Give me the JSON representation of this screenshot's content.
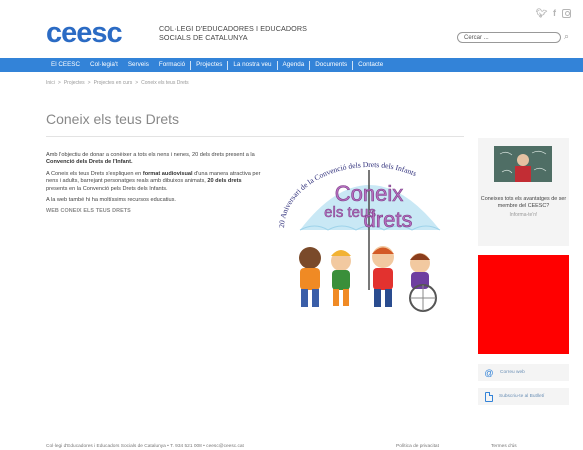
{
  "header": {
    "logo": "ceesc",
    "subtitle_line1": "COL·LEGI D'EDUCADORES I EDUCADORS",
    "subtitle_line2": "SOCIALS DE CATALUNYA",
    "search_value": "Cercar ...",
    "social_icons": [
      "twitter-icon",
      "facebook-icon",
      "instagram-icon"
    ]
  },
  "nav": {
    "items": [
      "El CEESC",
      "Col·legia't",
      "Serveis",
      "Formació",
      "Projectes",
      "La nostra veu",
      "Agenda",
      "Documents",
      "Contacte"
    ],
    "color": "#3383d8"
  },
  "breadcrumb": [
    "Inici",
    ">",
    "Projectes",
    ">",
    "Projectes en curs",
    ">",
    "Coneix els teus Drets"
  ],
  "page": {
    "title": "Coneix els teus Drets",
    "p1_a": "Amb l'objectiu de donar a conèixer a tots els nens i nenes, 20 dels drets present a la ",
    "p1_b": "Convenció dels Drets de l'Infant.",
    "p2_a": "A Coneix els teus Drets s'expliquen en ",
    "p2_b": "format audiovisual",
    "p2_c": " d'una manera atractiva per nens i adults, barrejant personatges reals amb dibuixos animats, ",
    "p2_d": "20 dels drets",
    "p2_e": " presents en la Convenció pels Drets dels Infants.",
    "p3": "A la web també hi ha moltíssims recursos educatius.",
    "web_link": "WEB CONEIX ELS TEUS DRETS"
  },
  "poster": {
    "arc_text": "20 Aniversari de la Convenció dels Drets dels Infants",
    "line1": "Coneix",
    "line2": "els teus",
    "line3": "drets"
  },
  "sidebar": {
    "card_text": "Coneixes tots els avantatges de ser membre del CEESC?",
    "card_more": "Informa-te'n!",
    "links": [
      {
        "icon": "at-icon",
        "label": "Correu web"
      },
      {
        "icon": "document-icon",
        "label": "Subscriu-te al Butlletí"
      }
    ]
  },
  "footer": {
    "left": "Col·legi d'Educadores i Educadors Socials de Catalunya  •  T. 934 521 008  •  ceesc@ceesc.cat",
    "policy": "Política de privacitat",
    "terms": "Termes d'ús"
  }
}
